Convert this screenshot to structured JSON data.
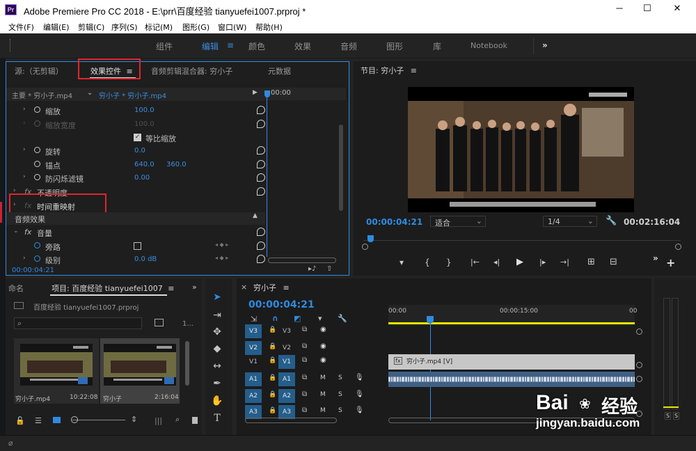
{
  "window": {
    "title": "Adobe Premiere Pro CC 2018 - E:\\prr\\百度经验 tianyuefei1007.prproj *",
    "app_icon": "Pr",
    "controls": [
      "─",
      "☐",
      "✕"
    ]
  },
  "menu": [
    "文件(F)",
    "编辑(E)",
    "剪辑(C)",
    "序列(S)",
    "标记(M)",
    "图形(G)",
    "窗口(W)",
    "帮助(H)"
  ],
  "workspaces": {
    "items": [
      "组件",
      "编辑",
      "颜色",
      "效果",
      "音频",
      "图形",
      "库",
      "Notebook"
    ],
    "active": "编辑",
    "more": "»"
  },
  "effect_controls": {
    "tabs": [
      "源:（无剪辑）",
      "效果控件",
      "音频剪辑混合器: 穷小子",
      "元数据"
    ],
    "tab_menu": "≡",
    "source_label": "主要 * 穷小子.mp4",
    "clip_label": "穷小子 * 穷小子.mp4",
    "ruler_time": "00:00",
    "rows": [
      {
        "label": "缩放",
        "value": "100.0"
      },
      {
        "label": "缩放宽度",
        "value": "100.0"
      },
      {
        "label": "等比缩放",
        "value": ""
      },
      {
        "label": "旋转",
        "value": "0.0"
      },
      {
        "label": "锚点",
        "value": "640.0",
        "value2": "360.0"
      },
      {
        "label": "防闪烁滤镜",
        "value": "0.00"
      },
      {
        "label": "不透明度",
        "value": ""
      },
      {
        "label": "时间重映射",
        "value": ""
      }
    ],
    "audio_section": "音频效果",
    "audio_rows": [
      {
        "label": "音量",
        "value": ""
      },
      {
        "label": "旁路",
        "value": ""
      },
      {
        "label": "级别",
        "value": "0.0 dB"
      }
    ],
    "timecode": "00:00:04:21",
    "fx_label": "fx"
  },
  "program_monitor": {
    "title": "节目: 穷小子",
    "menu": "≡",
    "timecode": "00:00:04:21",
    "fit": "适合",
    "resolution": "1/4",
    "duration": "00:02:16:04",
    "controls": [
      "▾",
      "{",
      "}",
      "|←",
      "◂|",
      "▶",
      "|▸",
      "→|",
      "⊞",
      "⊟"
    ],
    "more": "»",
    "add": "+"
  },
  "project_panel": {
    "tabs": [
      "命名",
      "项目: 百度经验 tianyuefei1007"
    ],
    "menu": "≡",
    "arrow": "»",
    "project_file": "百度经验 tianyuefei1007.prproj",
    "count": "1...",
    "items": [
      {
        "name": "穷小子.mp4",
        "duration": "10:22:08"
      },
      {
        "name": "穷小子",
        "duration": "2:16:04"
      }
    ]
  },
  "timeline": {
    "tab": "穷小子",
    "menu": "≡",
    "close": "×",
    "timecode": "00:00:04:21",
    "ruler": [
      "00:00",
      "00:00:15:00",
      "00"
    ],
    "video_tracks": [
      {
        "src": "V3",
        "name": "V3"
      },
      {
        "src": "V2",
        "name": "V2"
      },
      {
        "src": "V1",
        "name": "V1"
      }
    ],
    "audio_tracks": [
      {
        "src": "A1",
        "name": "A1"
      },
      {
        "src": "A2",
        "name": "A2"
      },
      {
        "src": "A3",
        "name": "A3"
      }
    ],
    "clip_video": "穷小子.mp4 [V]",
    "track_m": "M",
    "track_s": "S"
  },
  "audio_meter": {
    "solo": [
      "S",
      "S"
    ]
  },
  "watermark": {
    "logo": "Bai",
    "logo_zh": "经验",
    "url": "jingyan.baidu.com"
  },
  "colors": {
    "accent": "#2e8be0",
    "highlight": "#e0262c",
    "yellow": "#e8e800"
  }
}
